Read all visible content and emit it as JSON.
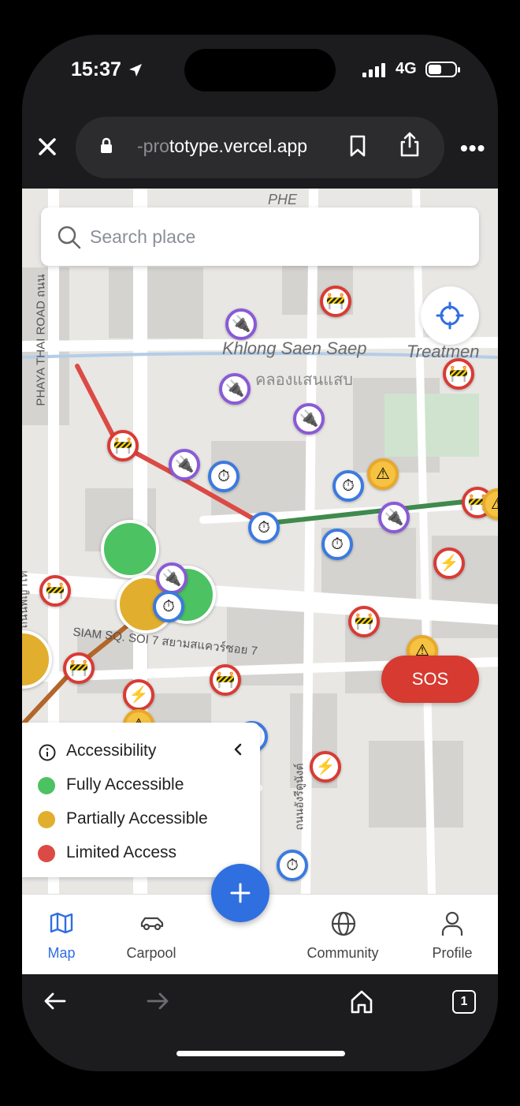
{
  "status_bar": {
    "time": "15:37",
    "network": "4G"
  },
  "browser": {
    "url_prefix": "-pro",
    "url_main": "totype.vercel.app"
  },
  "search": {
    "placeholder": "Search place"
  },
  "map": {
    "labels": {
      "khlong_en": "Khlong Saen Saep",
      "khlong_th": "คลองแสนแสบ",
      "treatment": "Treatmen",
      "road_phaya": "PHAYA THAI ROAD ถนน",
      "soi7": "SIAM SQ. SOI 7 สยามสแควร์ซอย 7",
      "top": "PHE",
      "road_left": "ถนนพญาไท",
      "road_bottom": "ถนนอังรีดูนังต์"
    }
  },
  "legend": {
    "title": "Accessibility",
    "items": [
      {
        "label": "Fully Accessible",
        "color": "#4cc262"
      },
      {
        "label": "Partially Accessible",
        "color": "#e2ae2e"
      },
      {
        "label": "Limited Access",
        "color": "#dc4a45"
      }
    ]
  },
  "sos": {
    "label": "SOS"
  },
  "tabs": [
    {
      "label": "Map",
      "icon": "map-icon",
      "active": true
    },
    {
      "label": "Carpool",
      "icon": "car-icon"
    },
    {
      "label": "Community",
      "icon": "globe-icon"
    },
    {
      "label": "Profile",
      "icon": "user-icon"
    }
  ],
  "browser_bottom": {
    "tab_count": "1"
  },
  "colors": {
    "accent": "#2f6fe0",
    "sos": "#d63a30"
  }
}
